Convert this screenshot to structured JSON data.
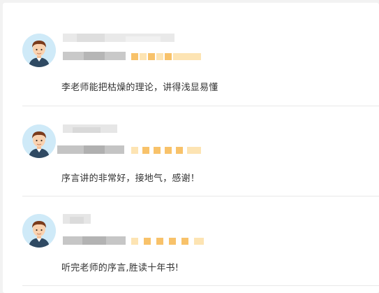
{
  "reviews": [
    {
      "rating": 5,
      "comment": "李老师能把枯燥的理论，讲得浅显易懂"
    },
    {
      "rating": 5,
      "comment": "序言讲的非常好，接地气，感谢！"
    },
    {
      "rating": 5,
      "comment": "听完老师的序言,胜读十年书!"
    }
  ],
  "colors": {
    "star": "#f8c26a",
    "divider": "#e8e8e8",
    "text": "#333333"
  },
  "icons": {
    "avatar": "default-user-avatar-icon"
  }
}
